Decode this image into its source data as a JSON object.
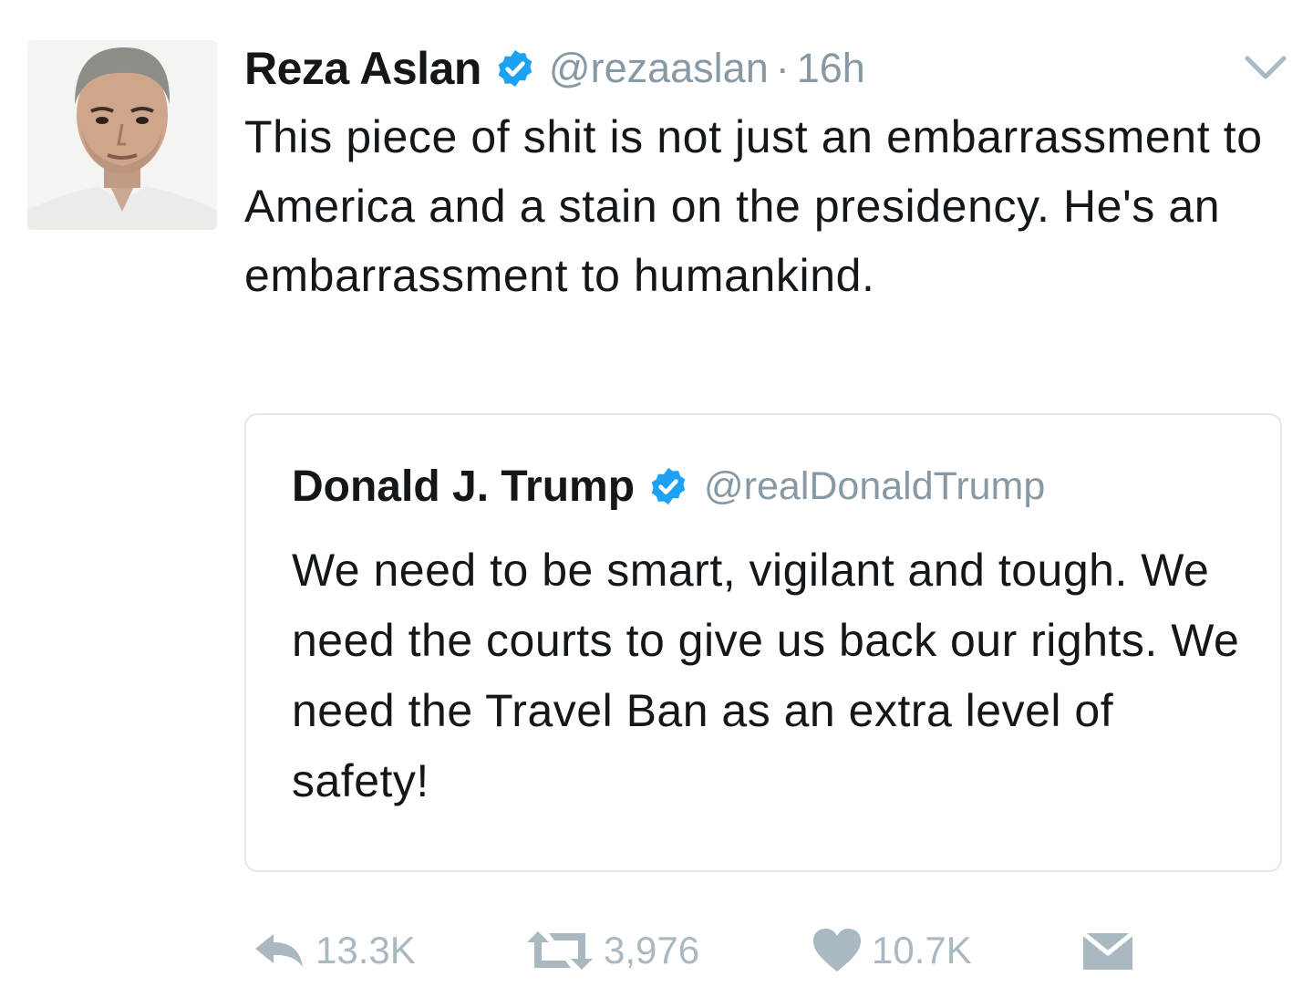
{
  "tweet": {
    "author": {
      "name": "Reza Aslan",
      "handle": "@rezaaslan",
      "verified": true,
      "avatar": "author-avatar-photo"
    },
    "separator": "·",
    "time": "16h",
    "text": "This piece of shit is not just an embarrassment to America and a stain on the presidency. He's an embarrassment to humankind.",
    "menu_icon": "chevron-down-icon"
  },
  "quoted_tweet": {
    "author": {
      "name": "Donald J. Trump",
      "handle": "@realDonaldTrump",
      "verified": true
    },
    "text": "We need to be smart, vigilant and tough. We need the courts to give us back our rights. We need the Travel Ban as an extra level of safety!"
  },
  "actions": {
    "reply": {
      "icon": "reply-icon",
      "count": "13.3K"
    },
    "retweet": {
      "icon": "retweet-icon",
      "count": "3,976"
    },
    "like": {
      "icon": "heart-icon",
      "count": "10.7K"
    },
    "dm": {
      "icon": "envelope-icon"
    }
  },
  "colors": {
    "text": "#14171a",
    "secondary": "#8899a6",
    "verified": "#1da1f2",
    "action_gray": "#aab8c2",
    "border": "#e1e8ed"
  }
}
